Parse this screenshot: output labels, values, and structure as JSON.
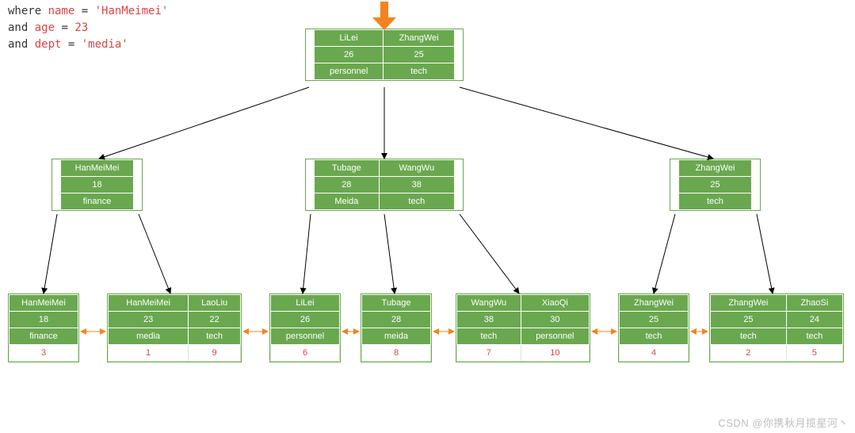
{
  "query": {
    "line1_kw": "where ",
    "line1_name_k": "name",
    "line1_eq": " = ",
    "line1_name_v": "'HanMeimei'",
    "line2_kw": "and ",
    "line2_age_k": "age",
    "line2_eq": " = ",
    "line2_age_v": "23",
    "line3_kw": "and ",
    "line3_dept_k": "dept",
    "line3_eq": " = ",
    "line3_dept_v": "'media'"
  },
  "colors": {
    "cell_bg": "#6aa84f",
    "cell_fg": "#ffffff",
    "accent_orange": "#f5821f",
    "accent_red": "#d44"
  },
  "root": {
    "cols": [
      {
        "name": "LiLei",
        "age": "26",
        "dept": "personnel"
      },
      {
        "name": "ZhangWei",
        "age": "25",
        "dept": "tech"
      }
    ]
  },
  "mid": [
    {
      "cols": [
        {
          "name": "HanMeiMei",
          "age": "18",
          "dept": "finance"
        }
      ]
    },
    {
      "cols": [
        {
          "name": "Tubage",
          "age": "28",
          "dept": "Meida"
        },
        {
          "name": "WangWu",
          "age": "38",
          "dept": "tech"
        }
      ]
    },
    {
      "cols": [
        {
          "name": "ZhangWei",
          "age": "25",
          "dept": "tech"
        }
      ]
    }
  ],
  "leaf": [
    {
      "cols": [
        {
          "name": "HanMeiMei",
          "age": "18",
          "dept": "finance",
          "id": "3"
        }
      ]
    },
    {
      "cols": [
        {
          "name": "HanMeiMei",
          "age": "23",
          "dept": "media",
          "id": "1"
        },
        {
          "name": "LaoLiu",
          "age": "22",
          "dept": "tech",
          "id": "9"
        }
      ]
    },
    {
      "cols": [
        {
          "name": "LiLei",
          "age": "26",
          "dept": "personnel",
          "id": "6"
        }
      ]
    },
    {
      "cols": [
        {
          "name": "Tubage",
          "age": "28",
          "dept": "meida",
          "id": "8"
        }
      ]
    },
    {
      "cols": [
        {
          "name": "WangWu",
          "age": "38",
          "dept": "tech",
          "id": "7"
        },
        {
          "name": "XiaoQi",
          "age": "30",
          "dept": "personnel",
          "id": "10"
        }
      ]
    },
    {
      "cols": [
        {
          "name": "ZhangWei",
          "age": "25",
          "dept": "tech",
          "id": "4"
        }
      ]
    },
    {
      "cols": [
        {
          "name": "ZhangWei",
          "age": "25",
          "dept": "tech",
          "id": "2"
        },
        {
          "name": "ZhaoSi",
          "age": "24",
          "dept": "tech",
          "id": "5"
        }
      ]
    }
  ],
  "watermark": "CSDN @你携秋月揽星河丶"
}
